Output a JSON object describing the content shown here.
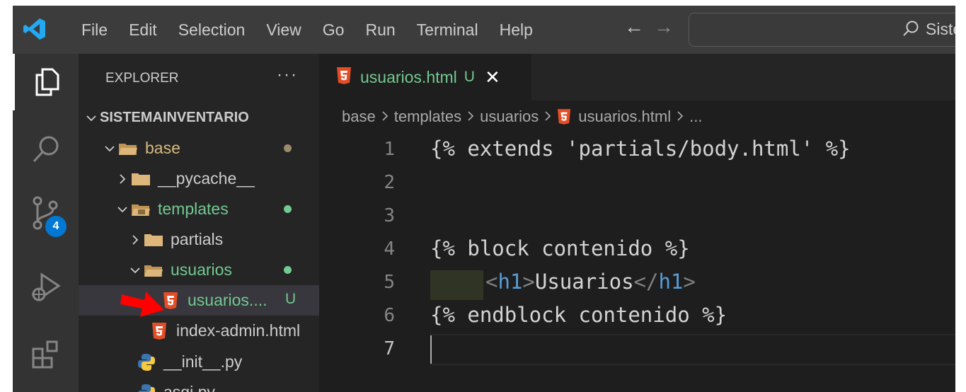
{
  "menu": [
    "File",
    "Edit",
    "Selection",
    "View",
    "Go",
    "Run",
    "Terminal",
    "Help"
  ],
  "nav": {
    "back": "←",
    "forward": "→"
  },
  "command_center": {
    "label": "Siste"
  },
  "activity": {
    "scm_badge": "4"
  },
  "explorer": {
    "title": "EXPLORER",
    "more": "···",
    "root": "SISTEMAINVENTARIO",
    "items": [
      {
        "label": "base"
      },
      {
        "label": "__pycache__"
      },
      {
        "label": "templates"
      },
      {
        "label": "partials"
      },
      {
        "label": "usuarios"
      },
      {
        "label": "usuarios....",
        "status": "U"
      },
      {
        "label": "index-admin.html"
      },
      {
        "label": "__init__.py"
      },
      {
        "label": "asgi.py"
      }
    ]
  },
  "tab": {
    "label": "usuarios.html",
    "status": "U",
    "close": "✕"
  },
  "breadcrumb": [
    "base",
    "templates",
    "usuarios",
    "usuarios.html",
    "..."
  ],
  "editor": {
    "line_numbers": [
      "1",
      "2",
      "3",
      "4",
      "5",
      "6",
      "7"
    ],
    "lines": {
      "l1": "{% extends 'partials/body.html' %}",
      "l4": "{% block contenido %}",
      "l5": {
        "open_lt": "<",
        "open_tag": "h1",
        "open_gt": ">",
        "text": "Usuarios",
        "close_lt": "</",
        "close_tag": "h1",
        "close_gt": ">"
      },
      "l6": "{% endblock contenido %}"
    }
  },
  "colors": {
    "accent": "#0078d4",
    "untracked": "#73c991",
    "html_icon": "#e44d26",
    "arrow": "#ff0000"
  }
}
